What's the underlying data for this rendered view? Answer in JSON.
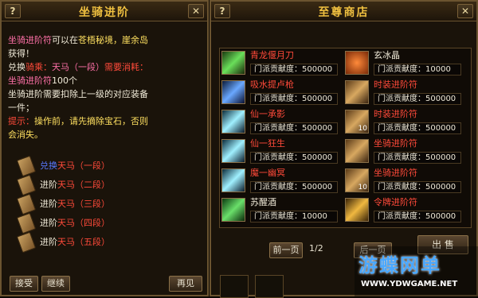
{
  "left_panel": {
    "help_label": "?",
    "title": "坐骑进阶",
    "close_label": "✕",
    "desc": [
      [
        {
          "t": "坐骑进阶符",
          "c": "pink"
        },
        {
          "t": "可以在",
          "c": "white"
        },
        {
          "t": "苍梧秘境，崖余岛",
          "c": "yellow"
        }
      ],
      [
        {
          "t": "获得！",
          "c": "white"
        }
      ],
      [
        {
          "t": "兑换",
          "c": "white"
        },
        {
          "t": "骑乘：",
          "c": "red"
        },
        {
          "t": "天马（一段）",
          "c": "pink"
        },
        {
          "t": "需要消耗：",
          "c": "red"
        }
      ],
      [
        {
          "t": "坐骑进阶符",
          "c": "pink"
        },
        {
          "t": "100个",
          "c": "white"
        }
      ],
      [
        {
          "t": "坐骑进阶需要扣除上一级的对应装备",
          "c": "white"
        }
      ],
      [
        {
          "t": "一件；",
          "c": "white"
        }
      ],
      [
        {
          "t": "提示：",
          "c": "red"
        },
        {
          "t": "操作前，请先摘除宝石，否则",
          "c": "yellow"
        }
      ],
      [
        {
          "t": "会消失。",
          "c": "yellow"
        }
      ]
    ],
    "tiers": [
      {
        "prefix": "兑换",
        "name": "天马（一段）",
        "prefix_color": "blue"
      },
      {
        "prefix": "进阶",
        "name": "天马（二段）",
        "prefix_color": "white"
      },
      {
        "prefix": "进阶",
        "name": "天马（三段）",
        "prefix_color": "white"
      },
      {
        "prefix": "进阶",
        "name": "天马（四段）",
        "prefix_color": "white"
      },
      {
        "prefix": "进阶",
        "name": "天马（五段）",
        "prefix_color": "white"
      }
    ],
    "accept_label": "接受",
    "continue_label": "继续",
    "goodbye_label": "再见"
  },
  "right_panel": {
    "help_label": "?",
    "title": "至尊商店",
    "close_label": "✕",
    "items": [
      {
        "name": "青龙偃月刀",
        "name_color": "#ff4a3a",
        "price": "门派贡献度：500000",
        "icon": "sword-icon",
        "count": ""
      },
      {
        "name": "玄冰晶",
        "name_color": "#f0ead8",
        "price": "门派贡献度：10000",
        "icon": "ice-crystal-icon",
        "count": ""
      },
      {
        "name": "吸水提卢枪",
        "name_color": "#ff4a3a",
        "price": "门派贡献度：500000",
        "icon": "spear-icon",
        "count": ""
      },
      {
        "name": "时装进阶符",
        "name_color": "#ff4a3a",
        "price": "门派贡献度：500000",
        "icon": "scroll-icon",
        "count": ""
      },
      {
        "name": "仙一承影",
        "name_color": "#ff4a3a",
        "price": "门派贡献度：500000",
        "icon": "light-sword-icon",
        "count": ""
      },
      {
        "name": "时装进阶符",
        "name_color": "#ff4a3a",
        "price": "门派贡献度：500000",
        "icon": "scroll-icon",
        "count": "10"
      },
      {
        "name": "仙一狂生",
        "name_color": "#ff4a3a",
        "price": "门派贡献度：500000",
        "icon": "light-sword-icon",
        "count": ""
      },
      {
        "name": "坐骑进阶符",
        "name_color": "#ff4a3a",
        "price": "门派贡献度：500000",
        "icon": "scroll-icon",
        "count": ""
      },
      {
        "name": "魔一幽冥",
        "name_color": "#ff4a3a",
        "price": "门派贡献度：500000",
        "icon": "light-sword-icon",
        "count": ""
      },
      {
        "name": "坐骑进阶符",
        "name_color": "#ff4a3a",
        "price": "门派贡献度：500000",
        "icon": "scroll-icon",
        "count": "10"
      },
      {
        "name": "苏醒酒",
        "name_color": "#f0ead8",
        "price": "门派贡献度：10000",
        "icon": "wine-icon",
        "count": ""
      },
      {
        "name": "令牌进阶符",
        "name_color": "#ff4a3a",
        "price": "门派贡献度：500000",
        "icon": "token-icon",
        "count": ""
      }
    ],
    "prev_page_label": "前一页",
    "page_indicator": "1/2",
    "next_page_label": "后一页",
    "sell_label": "出 售"
  },
  "watermark": {
    "logo_text": "游蝶网单",
    "url": "WWW.YDWGAME.NET"
  }
}
